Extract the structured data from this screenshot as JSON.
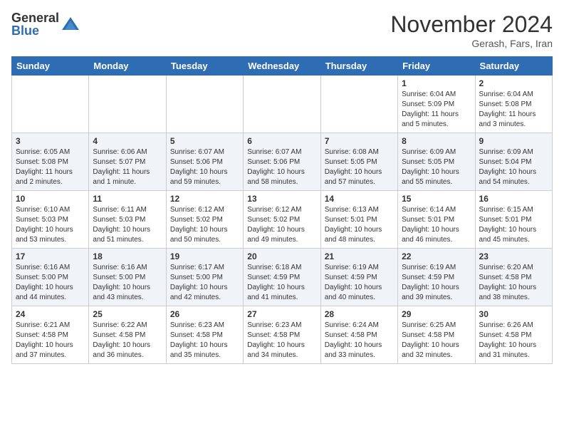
{
  "logo": {
    "general": "General",
    "blue": "Blue"
  },
  "header": {
    "month": "November 2024",
    "location": "Gerash, Fars, Iran"
  },
  "days_of_week": [
    "Sunday",
    "Monday",
    "Tuesday",
    "Wednesday",
    "Thursday",
    "Friday",
    "Saturday"
  ],
  "weeks": [
    [
      {
        "day": "",
        "info": ""
      },
      {
        "day": "",
        "info": ""
      },
      {
        "day": "",
        "info": ""
      },
      {
        "day": "",
        "info": ""
      },
      {
        "day": "",
        "info": ""
      },
      {
        "day": "1",
        "info": "Sunrise: 6:04 AM\nSunset: 5:09 PM\nDaylight: 11 hours\nand 5 minutes."
      },
      {
        "day": "2",
        "info": "Sunrise: 6:04 AM\nSunset: 5:08 PM\nDaylight: 11 hours\nand 3 minutes."
      }
    ],
    [
      {
        "day": "3",
        "info": "Sunrise: 6:05 AM\nSunset: 5:08 PM\nDaylight: 11 hours\nand 2 minutes."
      },
      {
        "day": "4",
        "info": "Sunrise: 6:06 AM\nSunset: 5:07 PM\nDaylight: 11 hours\nand 1 minute."
      },
      {
        "day": "5",
        "info": "Sunrise: 6:07 AM\nSunset: 5:06 PM\nDaylight: 10 hours\nand 59 minutes."
      },
      {
        "day": "6",
        "info": "Sunrise: 6:07 AM\nSunset: 5:06 PM\nDaylight: 10 hours\nand 58 minutes."
      },
      {
        "day": "7",
        "info": "Sunrise: 6:08 AM\nSunset: 5:05 PM\nDaylight: 10 hours\nand 57 minutes."
      },
      {
        "day": "8",
        "info": "Sunrise: 6:09 AM\nSunset: 5:05 PM\nDaylight: 10 hours\nand 55 minutes."
      },
      {
        "day": "9",
        "info": "Sunrise: 6:09 AM\nSunset: 5:04 PM\nDaylight: 10 hours\nand 54 minutes."
      }
    ],
    [
      {
        "day": "10",
        "info": "Sunrise: 6:10 AM\nSunset: 5:03 PM\nDaylight: 10 hours\nand 53 minutes."
      },
      {
        "day": "11",
        "info": "Sunrise: 6:11 AM\nSunset: 5:03 PM\nDaylight: 10 hours\nand 51 minutes."
      },
      {
        "day": "12",
        "info": "Sunrise: 6:12 AM\nSunset: 5:02 PM\nDaylight: 10 hours\nand 50 minutes."
      },
      {
        "day": "13",
        "info": "Sunrise: 6:12 AM\nSunset: 5:02 PM\nDaylight: 10 hours\nand 49 minutes."
      },
      {
        "day": "14",
        "info": "Sunrise: 6:13 AM\nSunset: 5:01 PM\nDaylight: 10 hours\nand 48 minutes."
      },
      {
        "day": "15",
        "info": "Sunrise: 6:14 AM\nSunset: 5:01 PM\nDaylight: 10 hours\nand 46 minutes."
      },
      {
        "day": "16",
        "info": "Sunrise: 6:15 AM\nSunset: 5:01 PM\nDaylight: 10 hours\nand 45 minutes."
      }
    ],
    [
      {
        "day": "17",
        "info": "Sunrise: 6:16 AM\nSunset: 5:00 PM\nDaylight: 10 hours\nand 44 minutes."
      },
      {
        "day": "18",
        "info": "Sunrise: 6:16 AM\nSunset: 5:00 PM\nDaylight: 10 hours\nand 43 minutes."
      },
      {
        "day": "19",
        "info": "Sunrise: 6:17 AM\nSunset: 5:00 PM\nDaylight: 10 hours\nand 42 minutes."
      },
      {
        "day": "20",
        "info": "Sunrise: 6:18 AM\nSunset: 4:59 PM\nDaylight: 10 hours\nand 41 minutes."
      },
      {
        "day": "21",
        "info": "Sunrise: 6:19 AM\nSunset: 4:59 PM\nDaylight: 10 hours\nand 40 minutes."
      },
      {
        "day": "22",
        "info": "Sunrise: 6:19 AM\nSunset: 4:59 PM\nDaylight: 10 hours\nand 39 minutes."
      },
      {
        "day": "23",
        "info": "Sunrise: 6:20 AM\nSunset: 4:58 PM\nDaylight: 10 hours\nand 38 minutes."
      }
    ],
    [
      {
        "day": "24",
        "info": "Sunrise: 6:21 AM\nSunset: 4:58 PM\nDaylight: 10 hours\nand 37 minutes."
      },
      {
        "day": "25",
        "info": "Sunrise: 6:22 AM\nSunset: 4:58 PM\nDaylight: 10 hours\nand 36 minutes."
      },
      {
        "day": "26",
        "info": "Sunrise: 6:23 AM\nSunset: 4:58 PM\nDaylight: 10 hours\nand 35 minutes."
      },
      {
        "day": "27",
        "info": "Sunrise: 6:23 AM\nSunset: 4:58 PM\nDaylight: 10 hours\nand 34 minutes."
      },
      {
        "day": "28",
        "info": "Sunrise: 6:24 AM\nSunset: 4:58 PM\nDaylight: 10 hours\nand 33 minutes."
      },
      {
        "day": "29",
        "info": "Sunrise: 6:25 AM\nSunset: 4:58 PM\nDaylight: 10 hours\nand 32 minutes."
      },
      {
        "day": "30",
        "info": "Sunrise: 6:26 AM\nSunset: 4:58 PM\nDaylight: 10 hours\nand 31 minutes."
      }
    ]
  ]
}
